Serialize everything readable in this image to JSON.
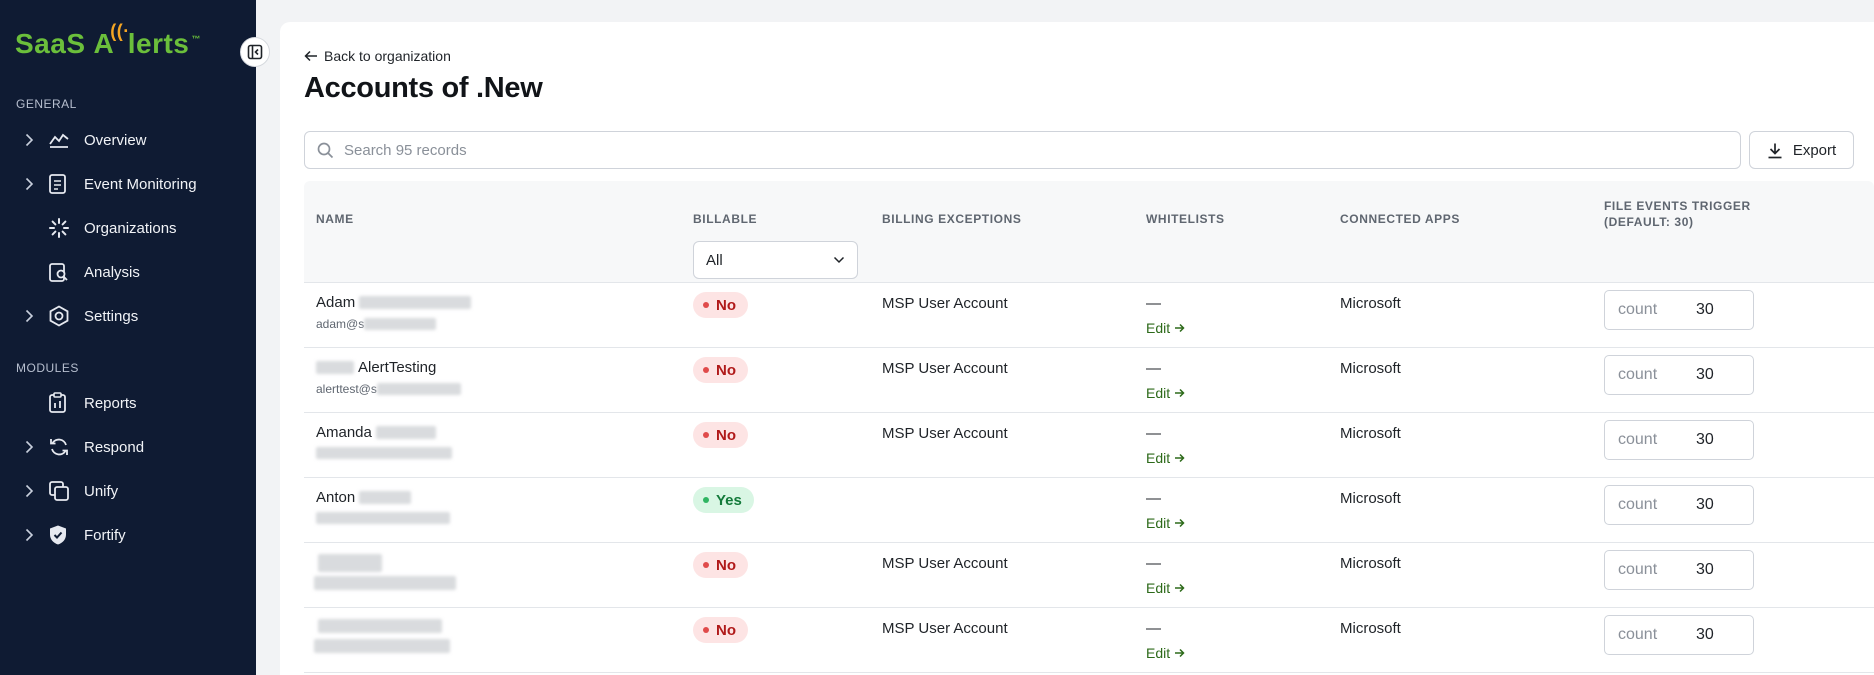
{
  "brand": {
    "logo_text_left": "SaaS",
    "logo_text_right": "lerts",
    "logo_mark": "A"
  },
  "sidebar": {
    "general_label": "GENERAL",
    "modules_label": "MODULES",
    "general_items": [
      {
        "label": "Overview",
        "icon": "chart-line-icon",
        "expandable": true
      },
      {
        "label": "Event Monitoring",
        "icon": "clipboard-list-icon",
        "expandable": true
      },
      {
        "label": "Organizations",
        "icon": "spinner-icon",
        "expandable": false
      },
      {
        "label": "Analysis",
        "icon": "clipboard-search-icon",
        "expandable": false
      },
      {
        "label": "Settings",
        "icon": "hexagon-gear-icon",
        "expandable": true
      }
    ],
    "module_items": [
      {
        "label": "Reports",
        "icon": "clipboard-report-icon",
        "expandable": false
      },
      {
        "label": "Respond",
        "icon": "refresh-cycle-icon",
        "expandable": true
      },
      {
        "label": "Unify",
        "icon": "stacked-squares-icon",
        "expandable": true
      },
      {
        "label": "Fortify",
        "icon": "shield-check-icon",
        "expandable": true
      }
    ]
  },
  "page": {
    "back_label": "Back to organization",
    "title": "Accounts of .New",
    "search_placeholder": "Search 95 records",
    "export_label": "Export"
  },
  "table": {
    "headers": {
      "name": "NAME",
      "billable": "BILLABLE",
      "billing_exceptions": "BILLING EXCEPTIONS",
      "whitelists": "WHITELISTS",
      "connected_apps": "CONNECTED APPS",
      "file_events_line1": "FILE EVENTS TRIGGER",
      "file_events_line2": "(DEFAULT: 30)"
    },
    "billable_filter": "All",
    "count_label": "count",
    "edit_label": "Edit",
    "rows": [
      {
        "name": "Adam",
        "email": "adam@s",
        "billable": "No",
        "billable_state": "no",
        "exception": "MSP User Account",
        "whitelist": "—",
        "app": "Microsoft",
        "count": "30"
      },
      {
        "name": "AlertTesting",
        "email": "alerttest@s",
        "billable": "No",
        "billable_state": "no",
        "exception": "MSP User Account",
        "whitelist": "—",
        "app": "Microsoft",
        "count": "30"
      },
      {
        "name": "Amanda",
        "email": "",
        "billable": "No",
        "billable_state": "no",
        "exception": "MSP User Account",
        "whitelist": "—",
        "app": "Microsoft",
        "count": "30"
      },
      {
        "name": "Anton",
        "email": "",
        "billable": "Yes",
        "billable_state": "yes",
        "exception": "",
        "whitelist": "—",
        "app": "Microsoft",
        "count": "30"
      },
      {
        "name": "",
        "email": "",
        "billable": "No",
        "billable_state": "no",
        "exception": "MSP User Account",
        "whitelist": "—",
        "app": "Microsoft",
        "count": "30"
      },
      {
        "name": "",
        "email": "",
        "billable": "No",
        "billable_state": "no",
        "exception": "MSP User Account",
        "whitelist": "—",
        "app": "Microsoft",
        "count": "30"
      }
    ]
  },
  "colors": {
    "sidebar_bg": "#0f1b33",
    "brand_green": "#6bbf3b",
    "brand_orange": "#f5a623",
    "edit_link": "#2d6a1a"
  }
}
